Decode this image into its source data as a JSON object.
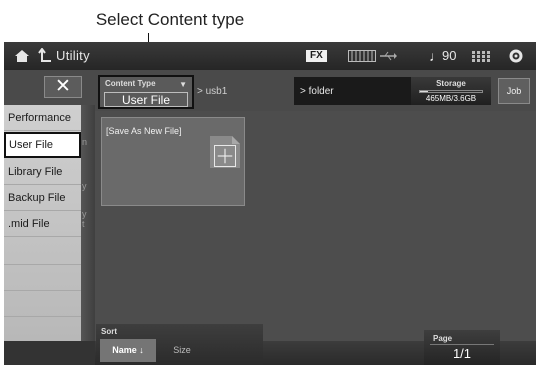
{
  "annotation": {
    "text": "Select Content type"
  },
  "topbar": {
    "title": "Utility",
    "fx_badge": "FX",
    "tempo_symbol": "♩",
    "tempo": "90",
    "icons": [
      "home-icon",
      "back-icon",
      "keyboard-icon",
      "usb-icon",
      "grid-icon",
      "settings-icon"
    ]
  },
  "close_label": "✕",
  "menu": {
    "items": [
      {
        "label": "Performance",
        "selected": false
      },
      {
        "label": "User File",
        "selected": true
      },
      {
        "label": "Library File",
        "selected": false
      },
      {
        "label": "Backup File",
        "selected": false
      },
      {
        "label": ".mid File",
        "selected": false
      }
    ]
  },
  "strip_glyphs": [
    "n",
    "y",
    "y",
    "t"
  ],
  "content_type": {
    "label": "Content Type",
    "value": "User File"
  },
  "path": {
    "device": "usb1",
    "folder": "folder"
  },
  "storage": {
    "label": "Storage",
    "value": "465MB/3.6GB",
    "used_fraction": 0.13
  },
  "job_label": "Job",
  "main": {
    "tile_label": "[Save As New File]"
  },
  "sort": {
    "label": "Sort",
    "options": [
      "Name ↓",
      "Size"
    ],
    "selected": "Name ↓"
  },
  "page": {
    "label": "Page",
    "value": "1/1"
  },
  "colors": {
    "screen_bg": "#4a4a4a",
    "menu_bg": "#c4c4c4",
    "selection_border": "#111111"
  }
}
